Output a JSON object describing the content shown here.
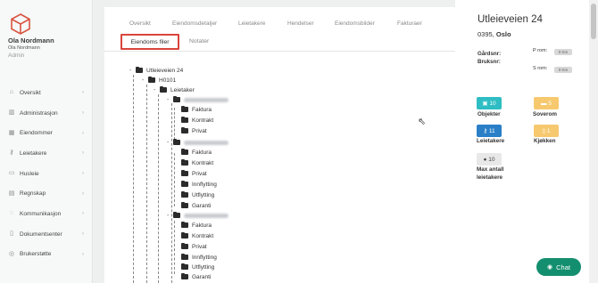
{
  "sidebar": {
    "user": {
      "name": "Ola Nordmann",
      "sub": "Ola Nordmann",
      "role": "Admin"
    },
    "items": [
      {
        "label": "Oversikt",
        "icon": "home-icon"
      },
      {
        "label": "Administrasjon",
        "icon": "bank-icon"
      },
      {
        "label": "Eiendommer",
        "icon": "building-icon"
      },
      {
        "label": "Leietakere",
        "icon": "key-icon"
      },
      {
        "label": "Husleie",
        "icon": "money-icon"
      },
      {
        "label": "Regnskap",
        "icon": "calculator-icon"
      },
      {
        "label": "Kommunikasjon",
        "icon": "chat-icon"
      },
      {
        "label": "Dokumentsenter",
        "icon": "document-icon"
      },
      {
        "label": "Brukerstøtte",
        "icon": "support-icon"
      }
    ]
  },
  "tabs": {
    "row1": [
      "Oversikt",
      "Eiendomsdetaljer",
      "Leietakere",
      "Hendelser",
      "Eiendomsbilder",
      "Fakturaer"
    ],
    "active": "Eiendoms filer",
    "notater": "Notater"
  },
  "tree": {
    "root": "Utleieveien 24",
    "unit": "H0101",
    "group": "Leietaker",
    "tenant1": [
      "Faktura",
      "Kontrakt",
      "Privat"
    ],
    "tenant2": [
      "Faktura",
      "Kontrakt",
      "Privat",
      "Innflytting",
      "Utflytting",
      "Garanti"
    ],
    "tenant3": [
      "Faktura",
      "Kontrakt",
      "Privat",
      "Innflytting",
      "Utflytting",
      "Garanti"
    ]
  },
  "property": {
    "title": "Utleieveien 24",
    "zip": "0395,",
    "city": "Oslo",
    "gardsnr_label": "Gårdsnr:",
    "bruksnr_label": "Bruksnr:",
    "p_rom_label": "P rom:",
    "s_rom_label": "S rom:",
    "pill1": "0 Km",
    "pill2": "0 Km"
  },
  "stats": [
    {
      "value": "10",
      "label": "Objekter",
      "color": "#2ebdc3",
      "icon": "cube-icon"
    },
    {
      "value": "5",
      "label": "Soverom",
      "color": "#f7c96f",
      "icon": "bed-icon"
    },
    {
      "value": "11",
      "label": "Leietakere",
      "color": "#2a7fc7",
      "icon": "key-icon"
    },
    {
      "value": "1",
      "label": "Kjøkken",
      "color": "#f7c96f",
      "icon": "kitchen-icon"
    },
    {
      "value": "10",
      "label1": "Max antall",
      "label2": "leietakere",
      "color": "#e8e8e8",
      "icon": "users-icon"
    }
  ],
  "chat": {
    "label": "Chat"
  }
}
